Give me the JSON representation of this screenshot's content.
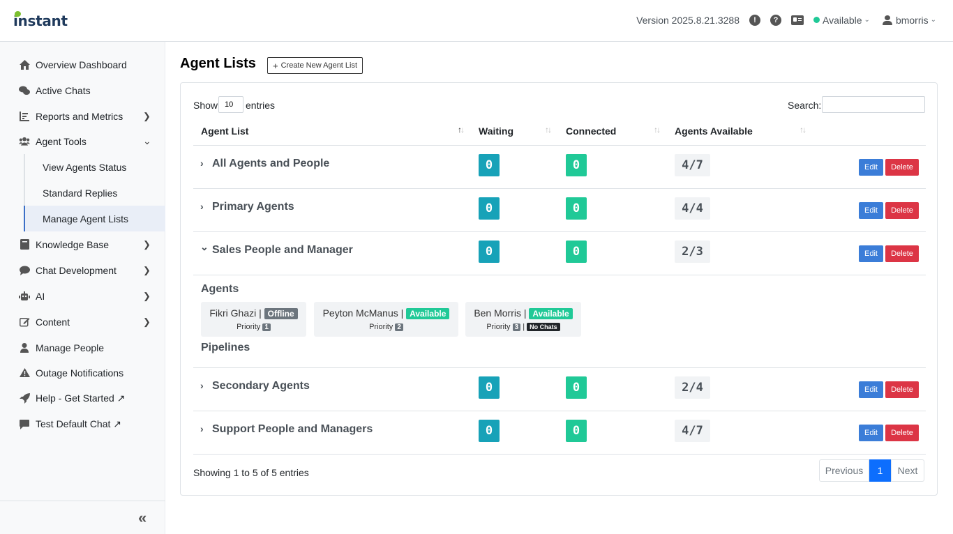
{
  "header": {
    "logo": "instant",
    "version": "Version 2025.8.21.3288",
    "status": "Available",
    "username": "bmorris",
    "icons": [
      "alert-icon",
      "help-icon",
      "id-card-icon",
      "status-dot",
      "user-icon"
    ]
  },
  "sidebar": {
    "items": [
      {
        "label": "Overview Dashboard",
        "icon": "home-icon"
      },
      {
        "label": "Active Chats",
        "icon": "chats-icon"
      },
      {
        "label": "Reports and Metrics",
        "icon": "chart-icon"
      },
      {
        "label": "Agent Tools",
        "icon": "users-icon"
      },
      {
        "label": "View Agents Status"
      },
      {
        "label": "Standard Replies"
      },
      {
        "label": "Manage Agent Lists"
      },
      {
        "label": "Knowledge Base",
        "icon": "book-icon"
      },
      {
        "label": "Chat Development",
        "icon": "comment-icon"
      },
      {
        "label": "AI",
        "icon": "robot-icon"
      },
      {
        "label": "Content",
        "icon": "edit-icon"
      },
      {
        "label": "Manage People",
        "icon": "person-icon"
      },
      {
        "label": "Outage Notifications",
        "icon": "warning-icon"
      },
      {
        "label": "Help - Get Started ↗",
        "icon": "rocket-icon"
      },
      {
        "label": "Test Default Chat ↗",
        "icon": "chat-bubble-icon"
      }
    ],
    "collapse": "«"
  },
  "main": {
    "title": "Agent Lists",
    "create_label": "Create New Agent List",
    "show_label": "Show",
    "show_value": "10",
    "entries_label": "entries",
    "search_label": "Search:",
    "columns": [
      "Agent List",
      "Waiting",
      "Connected",
      "Agents Available"
    ],
    "rows": [
      {
        "name": "All Agents and People",
        "waiting": "0",
        "connected": "0",
        "available": "4/7",
        "chev": "›"
      },
      {
        "name": "Primary Agents",
        "waiting": "0",
        "connected": "0",
        "available": "4/4",
        "chev": "›"
      },
      {
        "name": "Sales People and Manager",
        "waiting": "0",
        "connected": "0",
        "available": "2/3",
        "chev": "⌄"
      },
      {
        "name": "Secondary Agents",
        "waiting": "0",
        "connected": "0",
        "available": "2/4",
        "chev": "›"
      },
      {
        "name": "Support People and Managers",
        "waiting": "0",
        "connected": "0",
        "available": "4/7",
        "chev": "›"
      }
    ],
    "edit_label": "Edit",
    "delete_label": "Delete",
    "detail": {
      "agents_heading": "Agents",
      "pipelines_heading": "Pipelines",
      "priority_label": "Priority",
      "agents": [
        {
          "name": "Fikri Ghazi |",
          "status": "Offline",
          "priority": "1",
          "extra": ""
        },
        {
          "name": "Peyton McManus |",
          "status": "Available",
          "priority": "2",
          "extra": ""
        },
        {
          "name": "Ben Morris |",
          "status": "Available",
          "priority": "3",
          "extra": "No Chats"
        }
      ]
    },
    "showing": "Showing 1 to 5 of 5 entries",
    "pager": {
      "prev": "Previous",
      "current": "1",
      "next": "Next"
    }
  }
}
